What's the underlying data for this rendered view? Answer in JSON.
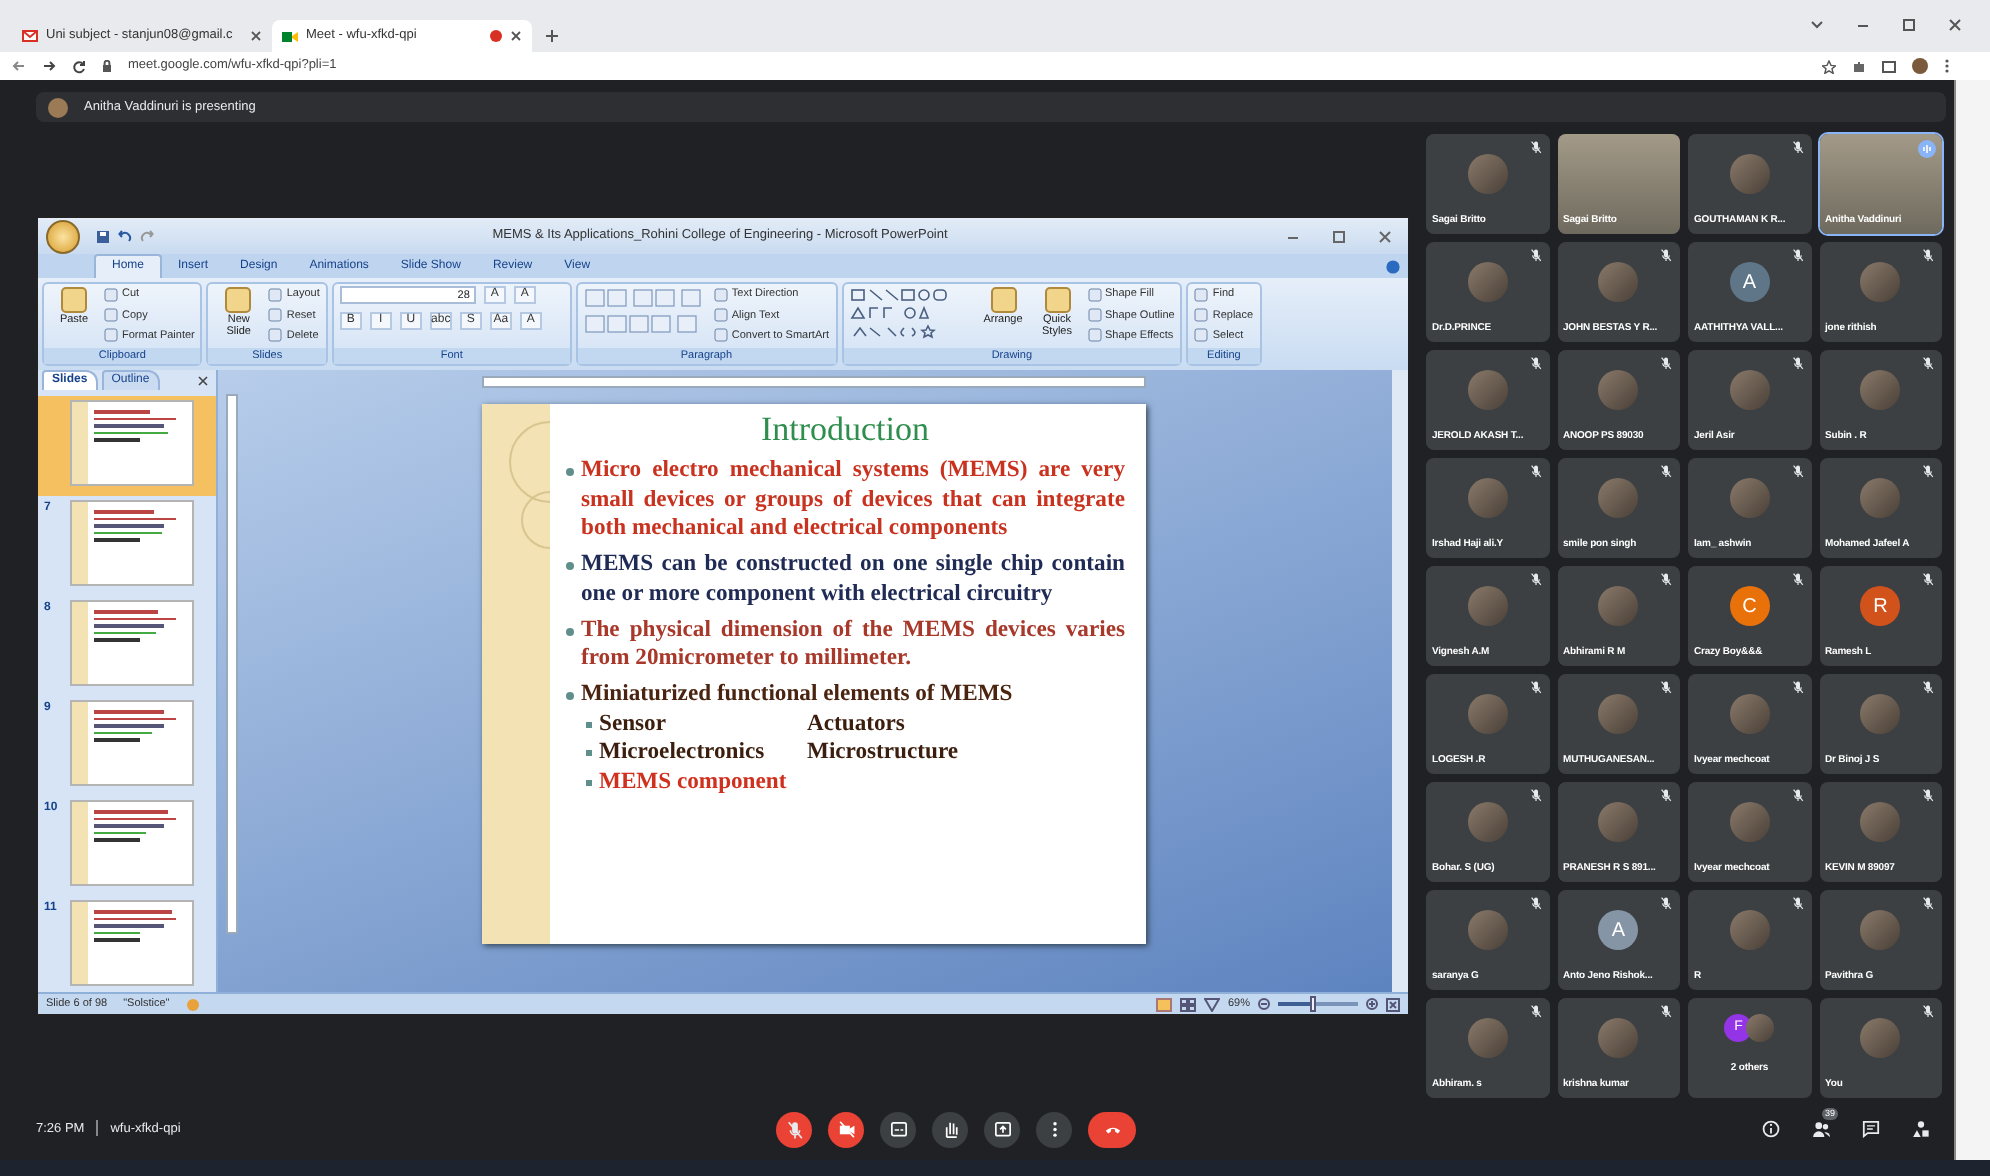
{
  "browser": {
    "tabs": [
      {
        "title": "Uni subject - stanjun08@gmail.c",
        "kind": "mail",
        "recording": false,
        "selected": false
      },
      {
        "title": "Meet - wfu-xfkd-qpi",
        "kind": "meet",
        "recording": true,
        "selected": true
      }
    ],
    "url": "meet.google.com/wfu-xfkd-qpi?pli=1"
  },
  "meet": {
    "presenter_banner": "Anitha Vaddinuri is presenting"
  },
  "powerpoint": {
    "title": "MEMS & Its Applications_Rohini College of Engineering - Microsoft PowerPoint",
    "ribbon_tabs": [
      {
        "label": "Home",
        "selected": true
      },
      {
        "label": "Insert",
        "selected": false
      },
      {
        "label": "Design",
        "selected": false
      },
      {
        "label": "Animations",
        "selected": false
      },
      {
        "label": "Slide Show",
        "selected": false
      },
      {
        "label": "Review",
        "selected": false
      },
      {
        "label": "View",
        "selected": false
      }
    ],
    "ribbon_groups": [
      {
        "label": "Clipboard",
        "items": [
          {
            "kind": "large",
            "label": "Paste"
          },
          {
            "kind": "small",
            "label": "Cut"
          },
          {
            "kind": "small",
            "label": "Copy"
          },
          {
            "kind": "small",
            "label": "Format Painter"
          }
        ]
      },
      {
        "label": "Slides",
        "items": [
          {
            "kind": "large",
            "label": "New Slide"
          },
          {
            "kind": "small",
            "label": "Layout"
          },
          {
            "kind": "small",
            "label": "Reset"
          },
          {
            "kind": "small",
            "label": "Delete"
          }
        ]
      },
      {
        "label": "Font",
        "items": [
          {
            "kind": "field",
            "value": "28"
          },
          {
            "kind": "tool",
            "label": "A"
          },
          {
            "kind": "tool",
            "label": "A"
          },
          {
            "kind": "tool",
            "label": "B"
          },
          {
            "kind": "tool",
            "label": "I"
          },
          {
            "kind": "tool",
            "label": "U"
          },
          {
            "kind": "tool",
            "label": "abc"
          },
          {
            "kind": "tool",
            "label": "S"
          },
          {
            "kind": "tool",
            "label": "Aa"
          },
          {
            "kind": "tool",
            "label": "A"
          }
        ]
      },
      {
        "label": "Paragraph",
        "items": [
          {
            "kind": "icons"
          },
          {
            "kind": "small",
            "label": "Text Direction"
          },
          {
            "kind": "small",
            "label": "Align Text"
          },
          {
            "kind": "small",
            "label": "Convert to SmartArt"
          }
        ]
      },
      {
        "label": "Drawing",
        "items": [
          {
            "kind": "gallery"
          },
          {
            "kind": "large",
            "label": "Arrange"
          },
          {
            "kind": "large",
            "label": "Quick Styles"
          },
          {
            "kind": "small",
            "label": "Shape Fill"
          },
          {
            "kind": "small",
            "label": "Shape Outline"
          },
          {
            "kind": "small",
            "label": "Shape Effects"
          }
        ]
      },
      {
        "label": "Editing",
        "items": [
          {
            "kind": "small",
            "label": "Find"
          },
          {
            "kind": "small",
            "label": "Replace"
          },
          {
            "kind": "small",
            "label": "Select"
          }
        ]
      }
    ],
    "pane_tabs": [
      {
        "label": "Slides",
        "selected": true
      },
      {
        "label": "Outline",
        "selected": false
      }
    ],
    "thumbnails": [
      {
        "selected": true
      },
      {
        "number": "7",
        "selected": false
      },
      {
        "number": "8",
        "selected": false
      },
      {
        "number": "9",
        "selected": false
      },
      {
        "number": "10",
        "selected": false
      },
      {
        "number": "11",
        "selected": false
      }
    ],
    "slide": {
      "title": "Introduction",
      "bullets": [
        {
          "text": "Micro electro mechanical systems (MEMS) are very small devices or groups of devices that can integrate both mechanical and electrical components",
          "color": "#c9321f"
        },
        {
          "text": "MEMS can be constructed on one single chip contain one or more component with electrical circuitry",
          "color": "#1f2a55"
        },
        {
          "text": "The physical dimension of the MEMS devices varies from 20micrometer to millimeter.",
          "color": "#a8382a"
        },
        {
          "text": "Miniaturized functional elements of MEMS",
          "color": "#4a2410",
          "children": [
            {
              "text": "Sensor",
              "text_2": "Actuators",
              "color": "#3b1e0e"
            },
            {
              "text": "Microelectronics",
              "text_2": "Microstructure",
              "color": "#3b1e0e"
            },
            {
              "text": "MEMS component",
              "color": "#d0311f"
            }
          ]
        }
      ]
    },
    "status": {
      "slide_info": "Slide 6 of 98",
      "theme": "\"Solstice\"",
      "zoom": "69%",
      "zoom_slider": {
        "level": 0.45
      }
    }
  },
  "participants": [
    {
      "name": "Sagai Britto",
      "kind": "photo",
      "mic_off": true,
      "speaking": false
    },
    {
      "name": "Sagai Britto",
      "kind": "video",
      "mic_off": false,
      "speaking": false
    },
    {
      "name": "GOUTHAMAN K R...",
      "kind": "photo",
      "mic_off": true,
      "speaking": false
    },
    {
      "name": "Anitha Vaddinuri",
      "kind": "video",
      "mic_off": false,
      "speaking": true
    },
    {
      "name": "Dr.D.PRINCE",
      "kind": "photo",
      "mic_off": true,
      "speaking": false
    },
    {
      "name": "JOHN BESTAS Y R...",
      "kind": "photo",
      "mic_off": true,
      "speaking": false
    },
    {
      "name": "AATHITHYA VALL...",
      "kind": "letter",
      "letter": "A",
      "color": "#5f7689",
      "mic_off": true,
      "speaking": false
    },
    {
      "name": "jone rithish",
      "kind": "photo",
      "mic_off": true,
      "speaking": false
    },
    {
      "name": "JEROLD AKASH T...",
      "kind": "photo",
      "mic_off": true,
      "speaking": false
    },
    {
      "name": "ANOOP PS 89030",
      "kind": "photo",
      "mic_off": true,
      "speaking": false
    },
    {
      "name": "Jeril Asir",
      "kind": "photo",
      "mic_off": true,
      "speaking": false
    },
    {
      "name": "Subin . R",
      "kind": "photo",
      "mic_off": true,
      "speaking": false
    },
    {
      "name": "Irshad Haji ali.Y",
      "kind": "photo",
      "mic_off": true,
      "speaking": false
    },
    {
      "name": "smile pon singh",
      "kind": "photo",
      "mic_off": true,
      "speaking": false
    },
    {
      "name": "Iam_ ashwin",
      "kind": "photo",
      "mic_off": true,
      "speaking": false
    },
    {
      "name": "Mohamed Jafeel A",
      "kind": "photo",
      "mic_off": true,
      "speaking": false
    },
    {
      "name": "Vignesh A.M",
      "kind": "photo",
      "mic_off": true,
      "speaking": false
    },
    {
      "name": "Abhirami R M",
      "kind": "photo",
      "mic_off": true,
      "speaking": false
    },
    {
      "name": "Crazy Boy&&&",
      "kind": "letter",
      "letter": "C",
      "color": "#e8710a",
      "mic_off": true,
      "speaking": false
    },
    {
      "name": "Ramesh L",
      "kind": "letter",
      "letter": "R",
      "color": "#d2521c",
      "mic_off": true,
      "speaking": false
    },
    {
      "name": "LOGESH .R",
      "kind": "photo",
      "mic_off": true,
      "speaking": false
    },
    {
      "name": "MUTHUGANESAN...",
      "kind": "photo",
      "mic_off": true,
      "speaking": false
    },
    {
      "name": "Ivyear mechcoat",
      "kind": "photo",
      "mic_off": true,
      "speaking": false
    },
    {
      "name": "Dr Binoj J S",
      "kind": "photo",
      "mic_off": true,
      "speaking": false
    },
    {
      "name": "Bohar. S (UG)",
      "kind": "photo",
      "mic_off": true,
      "speaking": false
    },
    {
      "name": "PRANESH R S 891...",
      "kind": "photo",
      "mic_off": true,
      "speaking": false
    },
    {
      "name": "Ivyear mechcoat",
      "kind": "photo",
      "mic_off": true,
      "speaking": false
    },
    {
      "name": "KEVIN M 89097",
      "kind": "photo",
      "mic_off": true,
      "speaking": false
    },
    {
      "name": "saranya G",
      "kind": "photo",
      "mic_off": true,
      "speaking": false
    },
    {
      "name": "Anto Jeno Rishok...",
      "kind": "letter",
      "letter": "A",
      "color": "#8595a5",
      "mic_off": true,
      "speaking": false
    },
    {
      "name": "R",
      "kind": "photo",
      "mic_off": true,
      "speaking": false
    },
    {
      "name": "Pavithra G",
      "kind": "photo",
      "mic_off": true,
      "speaking": false
    },
    {
      "name": "Abhiram. s",
      "kind": "photo",
      "mic_off": true,
      "speaking": false
    },
    {
      "name": "krishna kumar",
      "kind": "photo",
      "mic_off": true,
      "speaking": false
    },
    {
      "name": "2 others",
      "kind": "group",
      "letter": "F",
      "color": "#9334e6",
      "mic_off": false,
      "speaking": false
    },
    {
      "name": "You",
      "kind": "photo",
      "mic_off": true,
      "speaking": false
    }
  ],
  "bottom_bar": {
    "time": "7:26 PM",
    "meeting_code": "wfu-xfkd-qpi",
    "controls": [
      {
        "kind": "mic",
        "off": true
      },
      {
        "kind": "camera",
        "off": true
      },
      {
        "kind": "captions",
        "off": false
      },
      {
        "kind": "hand",
        "off": false
      },
      {
        "kind": "present",
        "off": false
      },
      {
        "kind": "more",
        "off": false
      },
      {
        "kind": "leave",
        "off": false
      }
    ],
    "side_icons": [
      {
        "kind": "info"
      },
      {
        "kind": "people",
        "badge": "39"
      },
      {
        "kind": "chat"
      },
      {
        "kind": "activities"
      }
    ]
  }
}
